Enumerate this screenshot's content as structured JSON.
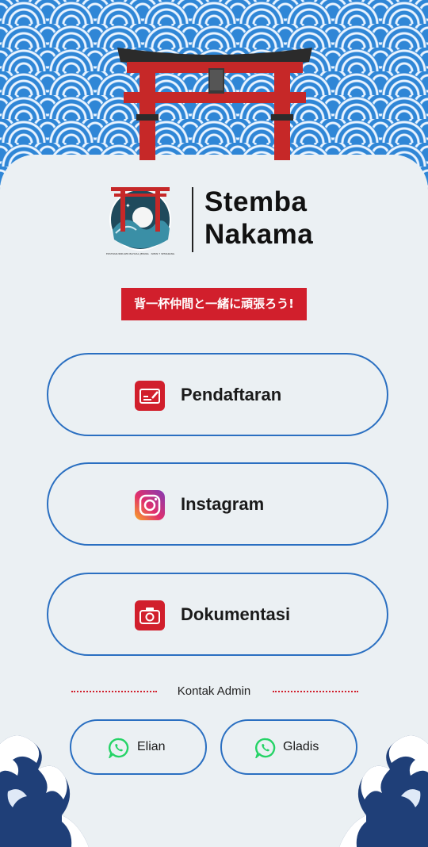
{
  "brand": {
    "title_line1": "Stemba",
    "title_line2": "Nakama",
    "logo_ring_text": "EKSTRAKURIKULER BAHASA JEPANG · SMKN 7 SEMARANG"
  },
  "tagline": "背一杯仲間と一緒に頑張ろう!",
  "links": [
    {
      "label": "Pendaftaran",
      "icon": "form-icon"
    },
    {
      "label": "Instagram",
      "icon": "instagram-icon"
    },
    {
      "label": "Dokumentasi",
      "icon": "camera-icon"
    }
  ],
  "contact": {
    "heading": "Kontak Admin",
    "admins": [
      {
        "label": "Elian",
        "icon": "whatsapp-icon"
      },
      {
        "label": "Gladis",
        "icon": "whatsapp-icon"
      }
    ]
  },
  "colors": {
    "accent_red": "#d11f2c",
    "border_blue": "#2a6fc1",
    "wave_blue": "#2f86d6",
    "card_bg": "#ebf0f3",
    "whatsapp_green": "#25d366"
  }
}
